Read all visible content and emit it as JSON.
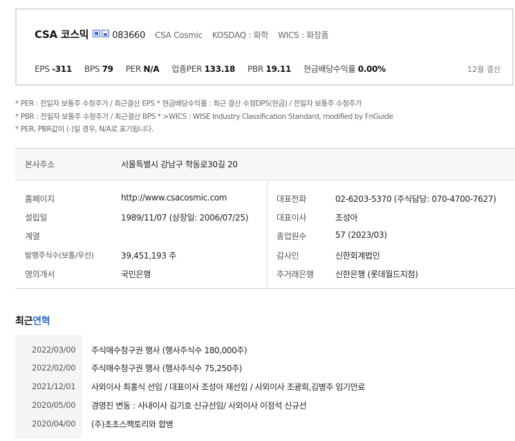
{
  "company": {
    "name": "CSA 코스믹",
    "code": "083660",
    "english_name": "CSA Cosmic",
    "market": "KOSDAQ : 화학",
    "wics": "WICS : 화장품"
  },
  "ratios": [
    {
      "label": "EPS",
      "value": "-311"
    },
    {
      "label": "BPS",
      "value": "79"
    },
    {
      "label": "PER",
      "value": "N/A"
    },
    {
      "label": "업종PER",
      "value": "133.18"
    },
    {
      "label": "PBR",
      "value": "19.11"
    },
    {
      "label": "현금배당수익률",
      "value": "0.00%"
    }
  ],
  "settlement": "12월 결산",
  "notes": [
    "* PER : 전일자 보통주 수정주가 / 최근결산 EPS * 현금배당수익률 : 최근 결산 수정DPS(현금) / 전일자 보통주 수정주가",
    "* PBR : 전일자 보통주 수정주가 / 최근결산 BPS * >WICS : WISE Industry Classification Standard, modified by FnGuide",
    "* PER, PBR값이 (-)일 경우, N/A로 표기됩니다."
  ],
  "info": {
    "address_label": "본사주소",
    "address": "서울특별시 강남구 학동로30길 20",
    "left": [
      {
        "label": "홈페이지",
        "value": "http://www.csacosmic.com"
      },
      {
        "label": "설립일",
        "value": "1989/11/07 (상장일: 2006/07/25)"
      },
      {
        "label": "계열",
        "value": ""
      },
      {
        "label": "발행주식수(보통/우선)",
        "value": "39,451,193 주"
      },
      {
        "label": "명의개서",
        "value": "국민은행"
      }
    ],
    "right": [
      {
        "label": "대표전화",
        "value": "02-6203-5370 (주식담당: 070-4700-7627)"
      },
      {
        "label": "대표이사",
        "value": "조성아"
      },
      {
        "label": "종업원수",
        "value": "57 (2023/03)"
      },
      {
        "label": "감사인",
        "value": "신한회계법인"
      },
      {
        "label": "주거래은행",
        "value": "신한은행 (롯데월드지점)"
      }
    ]
  },
  "history": {
    "title_prefix": "최근",
    "title_accent": "연혁",
    "items": [
      {
        "date": "2022/03/00",
        "desc": "주식매수청구권 행사 (행사주식수 180,000주)"
      },
      {
        "date": "2022/02/00",
        "desc": "주식매수청구권 행사 (행사주식수 75,250주)"
      },
      {
        "date": "2021/12/01",
        "desc": "사외이사 최홍식 선임 / 대표이사 조성아 재선임 / 사외이사 조광희,김병주 임기만료"
      },
      {
        "date": "2020/05/00",
        "desc": "경영진 변동 : 사내이사 김기호 신규선임/ 사외이사 이정석 신규선"
      },
      {
        "date": "2020/04/00",
        "desc": "(주)초초스팩토리와 합병"
      }
    ]
  }
}
